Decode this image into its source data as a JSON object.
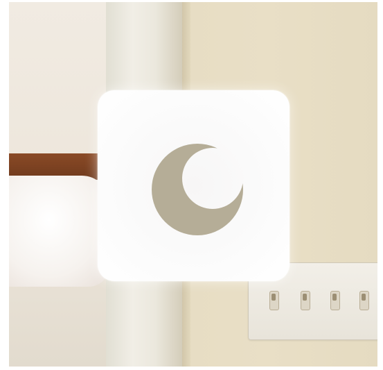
{
  "overlay": {
    "type": "focus-mode-toggle",
    "icon": "crescent-moon-icon",
    "card_color": "#ffffff",
    "icon_color": "#b5ad97"
  },
  "background": {
    "description_elements": [
      "wall",
      "door-frame",
      "bed-headboard",
      "pillow",
      "light-switch-plate"
    ]
  }
}
